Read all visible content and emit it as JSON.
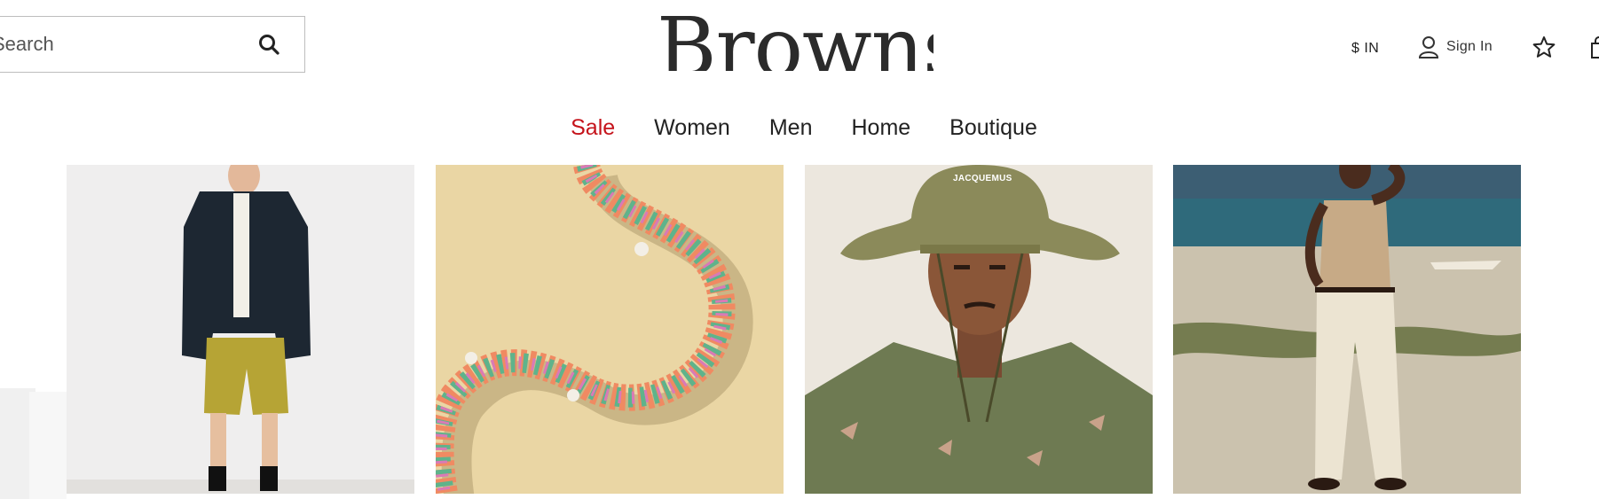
{
  "header": {
    "search": {
      "placeholder": "Search"
    },
    "logo": "Browns",
    "currency": "$ IN",
    "sign_in_label": "Sign In"
  },
  "nav": {
    "items": [
      {
        "label": "Sale",
        "highlight": true
      },
      {
        "label": "Women"
      },
      {
        "label": "Men"
      },
      {
        "label": "Home"
      },
      {
        "label": "Boutique"
      }
    ]
  },
  "gallery": {
    "hat_brand_text": "JACQUEMUS"
  },
  "colors": {
    "sale": "#c5131b",
    "text": "#222222",
    "border": "#bdbdbd"
  },
  "icons": {
    "search": "search-icon",
    "user": "user-icon",
    "wishlist": "star-icon",
    "bag": "bag-icon"
  }
}
